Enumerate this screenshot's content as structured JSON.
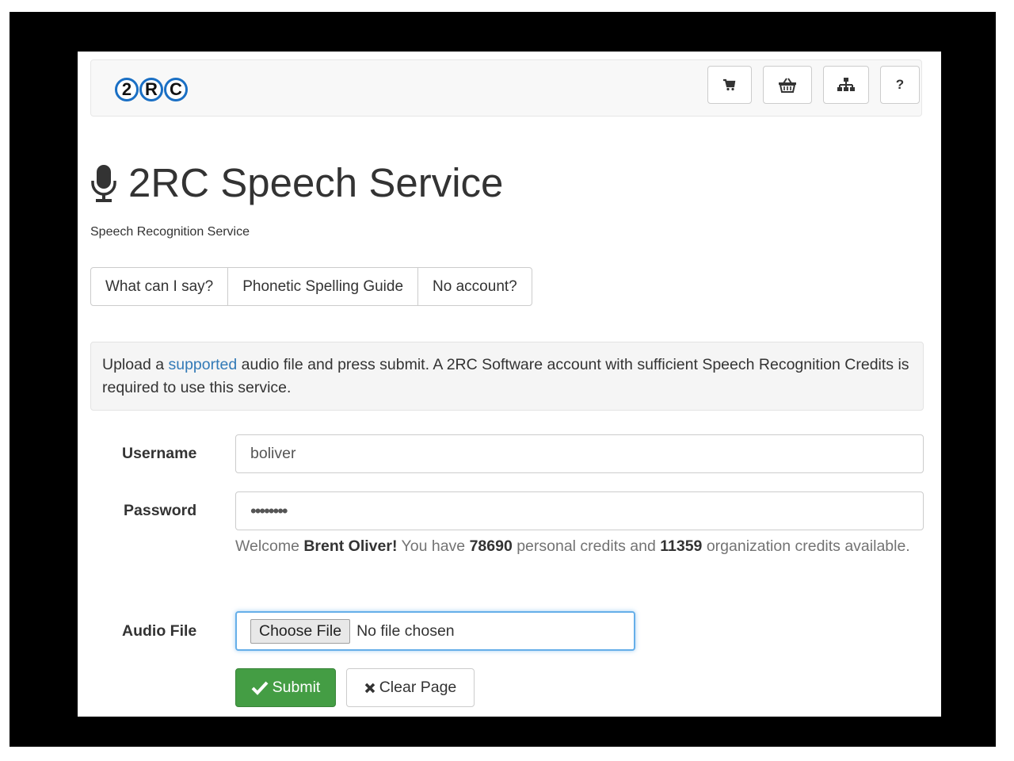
{
  "header": {
    "logo_letters": [
      "2",
      "R",
      "C"
    ],
    "nav_buttons": [
      {
        "icon": "shopping-cart-icon"
      },
      {
        "icon": "basket-icon"
      },
      {
        "icon": "sitemap-icon"
      },
      {
        "label": "?"
      }
    ]
  },
  "main": {
    "title_icon": "microphone-icon",
    "title": "2RC Speech Service",
    "subtitle": "Speech Recognition Service",
    "tabs": [
      {
        "label": "What can I say?"
      },
      {
        "label": "Phonetic Spelling Guide"
      },
      {
        "label": "No account?"
      }
    ],
    "info": {
      "prefix": "Upload a ",
      "link": "supported",
      "suffix": " audio file and press submit. A 2RC Software account with sufficient Speech Recognition Credits is required to use this service."
    }
  },
  "form": {
    "username_label": "Username",
    "username_value": "boliver",
    "password_label": "Password",
    "password_value": "••••••••",
    "welcome": {
      "prefix": "Welcome ",
      "name": "Brent Oliver!",
      "mid1": " You have ",
      "personal_credits": "78690",
      "mid2": " personal credits and ",
      "org_credits": "11359",
      "suffix": " organization credits available."
    },
    "audio_label": "Audio File",
    "choose_file_label": "Choose File",
    "no_file_text": "No file chosen",
    "submit_label": "Submit",
    "clear_label": "Clear Page"
  },
  "colors": {
    "accent_blue": "#1a6fc4",
    "link": "#337ab7",
    "success": "#449d44",
    "focus": "#66afe9"
  }
}
